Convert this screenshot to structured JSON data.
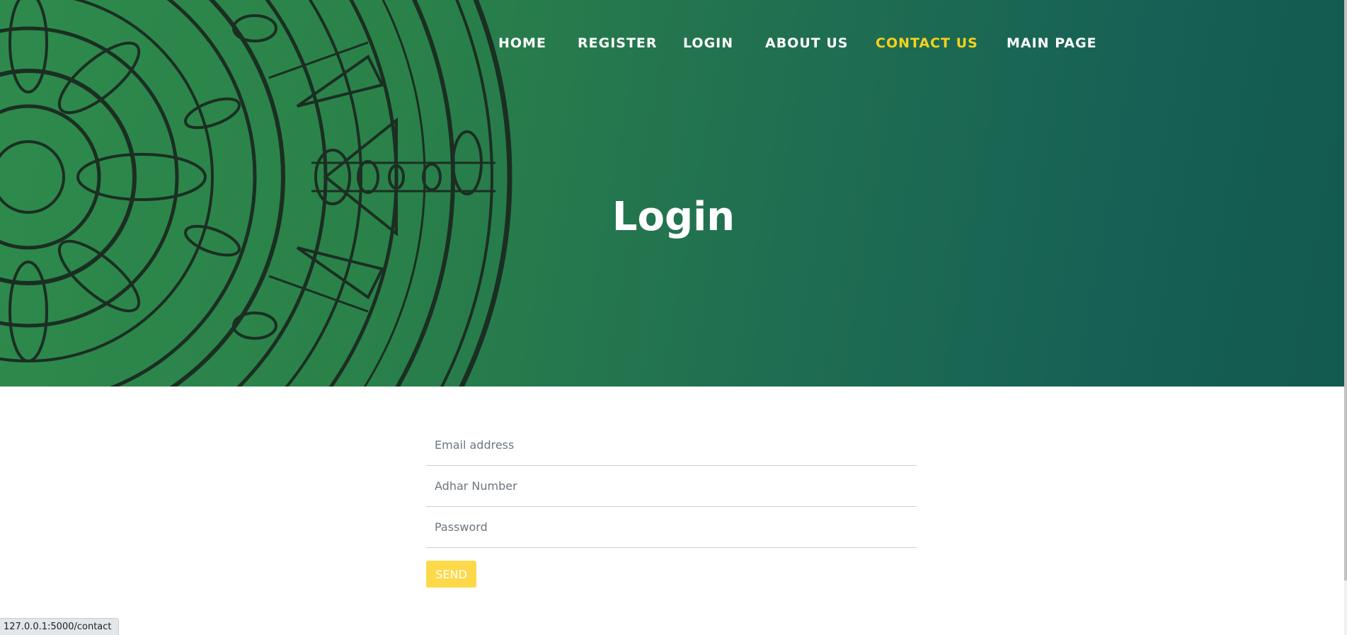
{
  "nav": {
    "items": [
      {
        "label": "HOME"
      },
      {
        "label": "REGISTER"
      },
      {
        "label": "LOGIN"
      },
      {
        "label": "ABOUT US"
      },
      {
        "label": "CONTACT US",
        "active": true
      },
      {
        "label": "MAIN PAGE"
      }
    ]
  },
  "hero": {
    "title": "Login"
  },
  "form": {
    "email_placeholder": "Email address",
    "adhar_placeholder": "Adhar Number",
    "password_placeholder": "Password",
    "send_label": "SEND"
  },
  "status_bar": {
    "url": "127.0.0.1:5000/contact"
  },
  "colors": {
    "accent_yellow": "#f6d21c",
    "button_yellow": "#fdd94a",
    "hero_green_start": "#2e8a4c",
    "hero_green_end": "#13594f"
  }
}
